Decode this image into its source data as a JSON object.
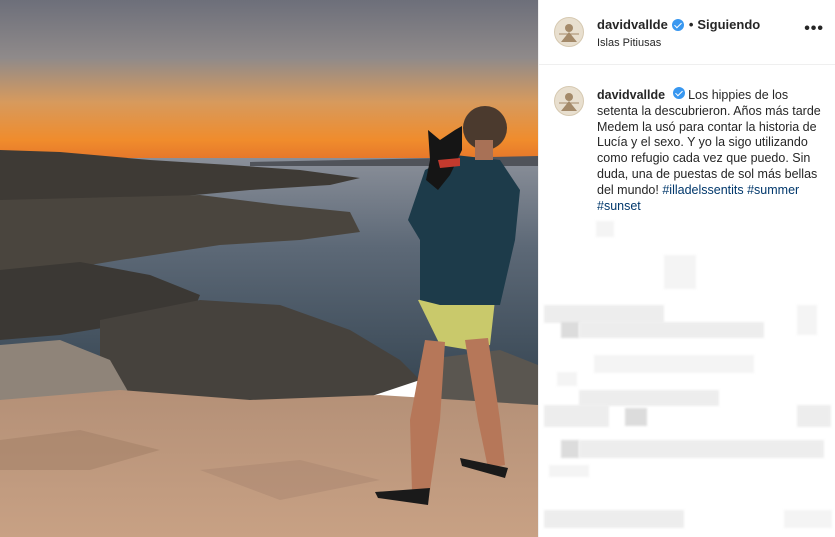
{
  "post": {
    "username": "davidvallde",
    "follow_status": "Siguiendo",
    "separator": "•",
    "location": "Islas Pitiusas",
    "more_label": "•••"
  },
  "caption": {
    "username": "davidvallde",
    "text": "Los hippies de los setenta la descubrieron. Años más tarde Medem la usó para contar la historia de Lucía y el sexo. Y yo la sigo utilizando como refugio cada vez que puedo. Sin duda, una de puestas de sol más bellas del mundo!",
    "hashtags": "#illadelssentits #summer #sunset"
  },
  "photo": {
    "subject": "man-holding-dog-at-sunset-coast"
  },
  "colors": {
    "verified": "#3897f0",
    "hashtag": "#00376b",
    "border": "#efefef"
  }
}
